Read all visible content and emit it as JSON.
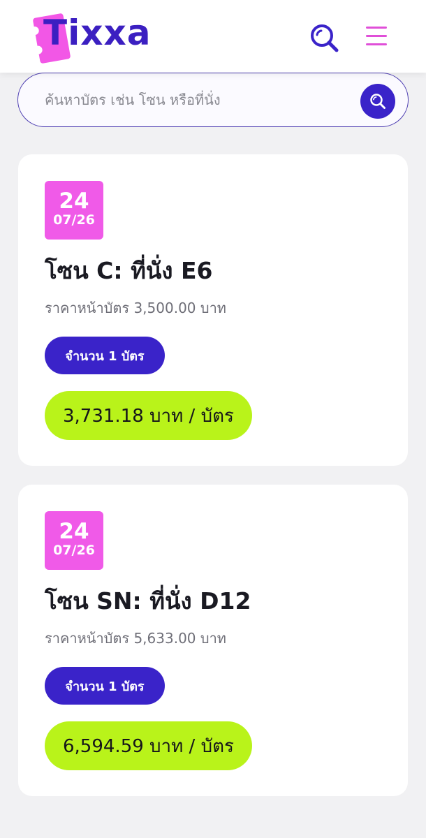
{
  "header": {
    "logo_text": "Tixxa",
    "search_icon": "search-icon",
    "menu_icon": "hamburger-menu-icon"
  },
  "search": {
    "placeholder": "ค้นหาบัตร เช่น โซน หรือที่นั่ง",
    "button_icon": "search-icon"
  },
  "colors": {
    "brand": "#3a23c9",
    "badge": "#f05ae8",
    "price": "#b9f31a"
  },
  "listings": [
    {
      "day": "24",
      "month_year": "07/26",
      "title": "โซน C: ที่นั่ง E6",
      "face_price": "ราคาหน้าบัตร 3,500.00 บาท",
      "quantity": "จำนวน 1 บัตร",
      "price": "3,731.18 บาท / บัตร"
    },
    {
      "day": "24",
      "month_year": "07/26",
      "title": "โซน SN: ที่นั่ง D12",
      "face_price": "ราคาหน้าบัตร 5,633.00 บาท",
      "quantity": "จำนวน 1 บัตร",
      "price": "6,594.59 บาท / บัตร"
    }
  ]
}
